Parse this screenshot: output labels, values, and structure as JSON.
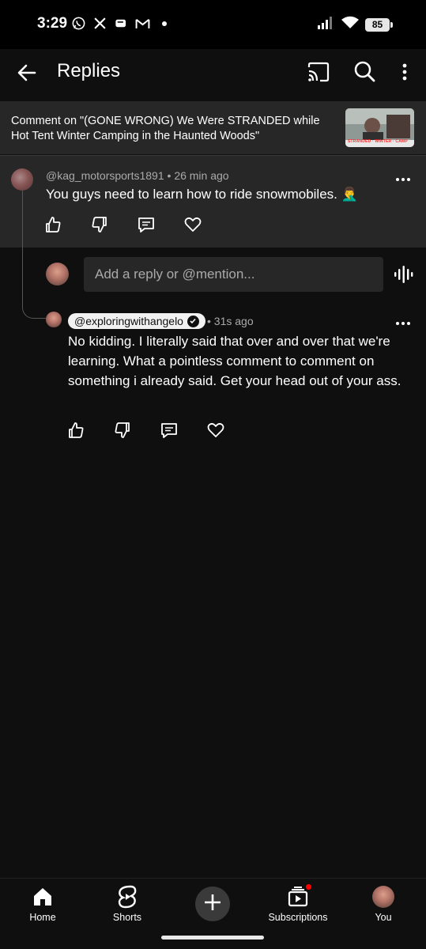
{
  "status_bar": {
    "time": "3:29",
    "battery": "85",
    "left_icons": [
      "whatsapp-icon",
      "x-icon",
      "messaging-icon",
      "gmail-icon",
      "dot-icon"
    ],
    "right_icons": [
      "signal-icon",
      "wifi-icon",
      "battery-icon"
    ]
  },
  "app_bar": {
    "title": "Replies"
  },
  "video": {
    "context_text": "Comment on \"(GONE WRONG) We Were STRANDED while Hot Tent Winter Camping in the Haunted Woods\""
  },
  "parent_comment": {
    "author": "@kag_motorsports1891",
    "time": "26 min ago",
    "text": "You guys need to learn how to ride snowmobiles. 🤦‍♂️"
  },
  "reply_box": {
    "placeholder": "Add a reply or @mention..."
  },
  "reply_comment": {
    "author": "@exploringwithangelo",
    "time": "31s ago",
    "text": "No kidding.  I literally said that over and over that we're learning.  What a pointless comment to comment on something i already said.  Get your head out of your ass."
  },
  "nav": {
    "home": "Home",
    "shorts": "Shorts",
    "subscriptions": "Subscriptions",
    "you": "You"
  },
  "colors": {
    "background": "#0f0f0f",
    "surface": "#272727",
    "notification_dot": "#ff0000"
  }
}
